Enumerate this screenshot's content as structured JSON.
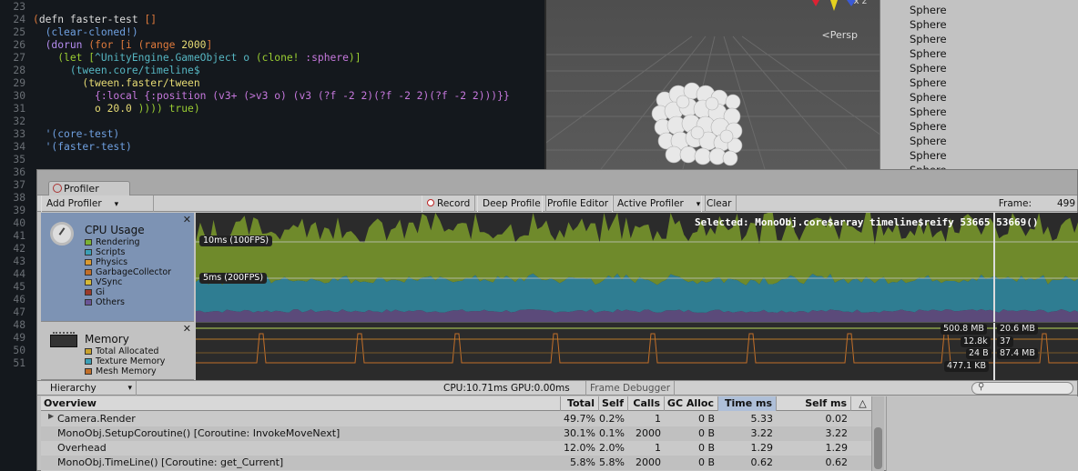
{
  "editor": {
    "lines": [
      {
        "n": "23",
        "parts": []
      },
      {
        "n": "24",
        "parts": [
          [
            "tk-paren",
            "("
          ],
          [
            "tk-fn",
            "defn faster-test "
          ],
          [
            "tk-paren",
            "[]"
          ]
        ]
      },
      {
        "n": "25",
        "parts": [
          [
            "",
            "  "
          ],
          [
            "tk-blue",
            "("
          ],
          [
            "tk-blue",
            "clear-cloned!"
          ],
          [
            "tk-blue",
            ")"
          ]
        ]
      },
      {
        "n": "26",
        "parts": [
          [
            "",
            "  "
          ],
          [
            "tk-purple",
            "(dorun "
          ],
          [
            "tk-paren",
            "(for [i (range "
          ],
          [
            "tk-num",
            "2000"
          ],
          [
            "tk-paren",
            "]"
          ]
        ]
      },
      {
        "n": "27",
        "parts": [
          [
            "",
            "    "
          ],
          [
            "tk-green",
            "(let ["
          ],
          [
            "tk-cyan",
            "^UnityEngine.GameObject o "
          ],
          [
            "tk-green",
            "(clone! "
          ],
          [
            "tk-kw",
            ":sphere"
          ],
          [
            "tk-green",
            ")]"
          ]
        ]
      },
      {
        "n": "28",
        "parts": [
          [
            "",
            "      "
          ],
          [
            "tk-cyan",
            "(tween.core/timeline$"
          ]
        ]
      },
      {
        "n": "29",
        "parts": [
          [
            "",
            "        "
          ],
          [
            "tk-num",
            "(tween.faster/tween"
          ]
        ]
      },
      {
        "n": "30",
        "parts": [
          [
            "",
            "          "
          ],
          [
            "tk-kw",
            "{:local {:position (v3+ (>v3 o) (v3 (?f -2 2)(?f -2 2)(?f -2 2)))}}"
          ]
        ]
      },
      {
        "n": "31",
        "parts": [
          [
            "",
            "          "
          ],
          [
            "tk-num",
            "o 20.0 "
          ],
          [
            "tk-green",
            ")))) true)"
          ]
        ]
      },
      {
        "n": "32",
        "parts": []
      },
      {
        "n": "33",
        "parts": [
          [
            "",
            "  "
          ],
          [
            "tk-blue",
            "'(core-test)"
          ]
        ]
      },
      {
        "n": "34",
        "parts": [
          [
            "",
            "  "
          ],
          [
            "tk-blue",
            "'(faster-test)"
          ]
        ]
      },
      {
        "n": "35",
        "parts": []
      },
      {
        "n": "36",
        "parts": []
      },
      {
        "n": "37",
        "parts": []
      },
      {
        "n": "38",
        "parts": []
      },
      {
        "n": "39",
        "parts": []
      },
      {
        "n": "40",
        "parts": []
      },
      {
        "n": "41",
        "parts": []
      },
      {
        "n": "42",
        "parts": []
      },
      {
        "n": "43",
        "parts": []
      },
      {
        "n": "44",
        "parts": []
      },
      {
        "n": "45",
        "parts": []
      },
      {
        "n": "46",
        "parts": []
      },
      {
        "n": "47",
        "parts": []
      },
      {
        "n": "48",
        "parts": []
      },
      {
        "n": "49",
        "parts": []
      },
      {
        "n": "50",
        "parts": []
      },
      {
        "n": "51",
        "parts": []
      }
    ]
  },
  "scene": {
    "persp_label": "Persp",
    "gizmo": "x            z"
  },
  "hierarchy_panel": {
    "items": [
      "Sphere",
      "Sphere",
      "Sphere",
      "Sphere",
      "Sphere",
      "Sphere",
      "Sphere",
      "Sphere",
      "Sphere",
      "Sphere",
      "Sphere",
      "Sphere"
    ]
  },
  "profiler": {
    "tab_label": "Profiler",
    "toolbar": {
      "add_profiler": "Add Profiler",
      "record": "Record",
      "deep_profile": "Deep Profile",
      "profile_editor": "Profile Editor",
      "active_profiler": "Active Profiler",
      "clear": "Clear",
      "frame_label": "Frame:",
      "frame_value": "499"
    },
    "cpu": {
      "title": "CPU Usage",
      "legend": [
        {
          "label": "Rendering",
          "color": "#7bb235"
        },
        {
          "label": "Scripts",
          "color": "#3b9fb6"
        },
        {
          "label": "Physics",
          "color": "#d99a32"
        },
        {
          "label": "GarbageCollector",
          "color": "#c26f29"
        },
        {
          "label": "VSync",
          "color": "#d5b837"
        },
        {
          "label": "Gi",
          "color": "#9b3a2a"
        },
        {
          "label": "Others",
          "color": "#6a5597"
        }
      ],
      "label_10ms": "10ms (100FPS)",
      "label_5ms": "5ms (200FPS)",
      "selected": "Selected: MonoObj.core$array timeline$reify   53665   53669()"
    },
    "memory": {
      "title": "Memory",
      "legend": [
        {
          "label": "Total Allocated",
          "color": "#c9a22e"
        },
        {
          "label": "Texture Memory",
          "color": "#3b9fb6"
        },
        {
          "label": "Mesh Memory",
          "color": "#c26f29"
        }
      ],
      "values_left": [
        "500.8 MB",
        "12.8k",
        "24 B",
        "477.1 KB"
      ],
      "values_right": [
        "20.6 MB",
        "37",
        "87.4 MB"
      ]
    },
    "bottom": {
      "view": "Hierarchy",
      "cpu_gpu": "CPU:10.71ms   GPU:0.00ms",
      "frame_debugger": "Frame Debugger"
    },
    "table": {
      "headers": [
        "Overview",
        "Total",
        "Self",
        "Calls",
        "GC Alloc",
        "Time ms",
        "Self ms"
      ],
      "rows": [
        {
          "name": "Camera.Render",
          "total": "49.7%",
          "self": "0.2%",
          "calls": "1",
          "gc": "0 B",
          "time": "5.33",
          "selfms": "0.02",
          "expandable": true
        },
        {
          "name": "MonoObj.SetupCoroutine() [Coroutine: InvokeMoveNext]",
          "total": "30.1%",
          "self": "0.1%",
          "calls": "2000",
          "gc": "0 B",
          "time": "3.22",
          "selfms": "3.22",
          "expandable": false
        },
        {
          "name": "Overhead",
          "total": "12.0%",
          "self": "2.0%",
          "calls": "1",
          "gc": "0 B",
          "time": "1.29",
          "selfms": "1.29",
          "expandable": false
        },
        {
          "name": "MonoObj.TimeLine() [Coroutine: get_Current]",
          "total": "5.8%",
          "self": "5.8%",
          "calls": "2000",
          "gc": "0 B",
          "time": "0.62",
          "selfms": "0.62",
          "expandable": false
        }
      ]
    }
  }
}
